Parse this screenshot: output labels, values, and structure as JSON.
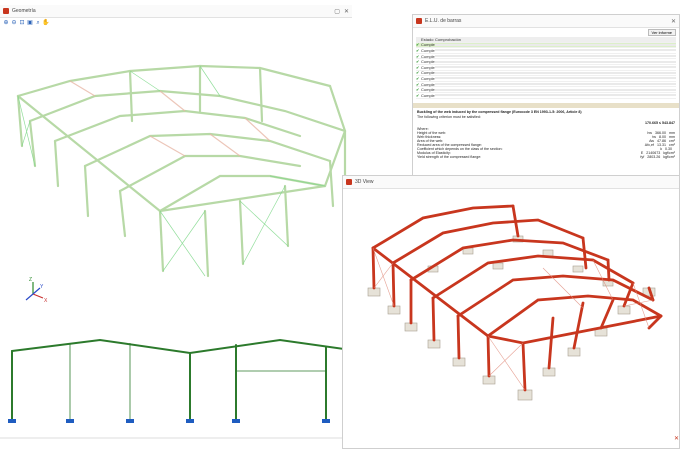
{
  "colors": {
    "accent": "#c8361e",
    "frame_green": "#2c7a2c",
    "steel_red": "#c8361e",
    "highlight": "#cfe8bf"
  },
  "win_left": {
    "title": "Geometría",
    "toolbar_icons": [
      "zoom-in-icon",
      "zoom-out-icon",
      "zoom-window-icon",
      "zoom-all-icon",
      "search-icon",
      "pan-hand-icon"
    ],
    "axis_x": "X",
    "axis_y": "Y",
    "axis_z": "Z"
  },
  "win_right": {
    "title": "E.L.U. de barras",
    "button": "Ver informe",
    "col_status": "Estado",
    "col_check": "Comprobación",
    "rows": [
      "Cumple",
      "Cumple",
      "Cumple",
      "Cumple",
      "Cumple",
      "Cumple",
      "Cumple",
      "Cumple",
      "Cumple",
      "Cumple"
    ],
    "report_title": "Buckling of the web induced by the compressed flange (Eurocode 3 EN 1993-1-5: 2006, Article 8)",
    "report_subtitle": "The following criterion must be satisfied:",
    "result": "170.665 ≤ 543.847",
    "where_label": "Where:",
    "param_rows": [
      {
        "label": "Height of the web:",
        "symbol": "hw",
        "value": "366.00",
        "unit": "mm"
      },
      {
        "label": "Web thickness:",
        "symbol": "tw",
        "value": "8.00",
        "unit": "mm"
      },
      {
        "label": "Area of the web:",
        "symbol": "Aw",
        "value": "47.86",
        "unit": "cm²"
      },
      {
        "label": "Reduced area of the compressed flange:",
        "symbol": "Afc,ef",
        "value": "13.31",
        "unit": "cm²"
      },
      {
        "label": "Coefficient which depends on the class of the section:",
        "symbol": "k",
        "value": "0.30",
        "unit": ""
      },
      {
        "label": "Modulus of Elasticity:",
        "symbol": "E",
        "value": "2140673",
        "unit": "kgf/cm²"
      },
      {
        "label": "Yield strength of the compressed flange:",
        "symbol": "fyf",
        "value": "2803.26",
        "unit": "kgf/cm²"
      }
    ]
  },
  "win_3d": {
    "title": "3D View"
  }
}
